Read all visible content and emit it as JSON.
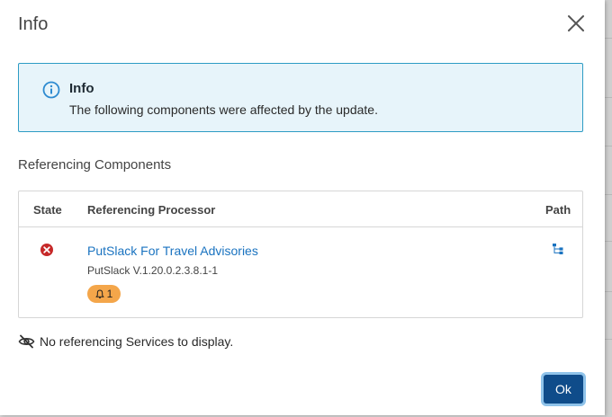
{
  "dialog": {
    "title": "Info"
  },
  "banner": {
    "title": "Info",
    "message": "The following components were affected by the update."
  },
  "referencing": {
    "section_title": "Referencing Components",
    "columns": {
      "state": "State",
      "processor": "Referencing Processor",
      "path": "Path"
    },
    "rows": [
      {
        "state": "invalid",
        "name": "PutSlack For Travel Advisories",
        "version": "PutSlack V.1.20.0.2.3.8.1-1",
        "bulletin_count": "1"
      }
    ]
  },
  "services": {
    "empty_message": "No referencing Services to display."
  },
  "footer": {
    "ok_label": "Ok"
  },
  "colors": {
    "accent": "#0f4c8a",
    "link": "#1a73c0",
    "info_border": "#2d9cc4",
    "info_bg": "#e7f4fa",
    "error": "#c62828",
    "bulletin": "#f4a64a"
  },
  "icons": {
    "close": "close-icon",
    "info": "info-circle-icon",
    "state": "error-circle-icon",
    "bulletin": "bell-icon",
    "path": "hierarchy-icon",
    "services": "eye-off-icon"
  }
}
